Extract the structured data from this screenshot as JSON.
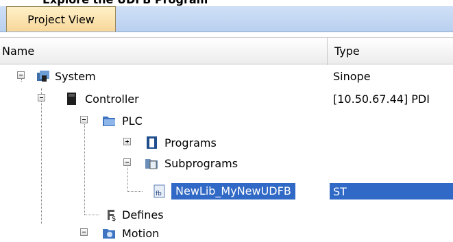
{
  "top_cut_text": "Explore the UDFB Program",
  "panel": {
    "tab_label": "Project View"
  },
  "columns": {
    "name": "Name",
    "type": "Type"
  },
  "tree": {
    "system": {
      "label": "System",
      "type": "Sinope",
      "icon": "system-icon"
    },
    "controller": {
      "label": "Controller",
      "type": "[10.50.67.44] PDI",
      "icon": "controller-icon"
    },
    "plc": {
      "label": "PLC",
      "type": "",
      "icon": "plc-folder-icon"
    },
    "programs": {
      "label": "Programs",
      "type": "",
      "icon": "programs-icon"
    },
    "subprograms": {
      "label": "Subprograms",
      "type": "",
      "icon": "subprograms-icon"
    },
    "udfb": {
      "label": "NewLib_MyNewUDFB",
      "type": "ST",
      "icon": "udfb-icon",
      "selected": true
    },
    "defines": {
      "label": "Defines",
      "type": "",
      "icon": "defines-icon"
    },
    "motion": {
      "label": "Motion",
      "type": "",
      "icon": "motion-icon"
    }
  },
  "colors": {
    "selection": "#3169c6",
    "tab": "#f7d79a",
    "band": "#c3d6f2"
  }
}
